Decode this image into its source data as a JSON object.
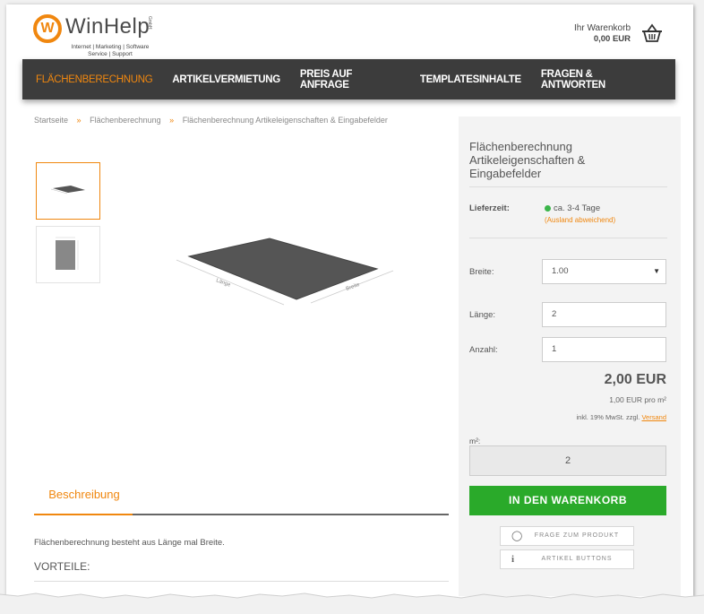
{
  "brand": {
    "name": "WinHelp",
    "legal": "GmbH",
    "tagline_line1": "Internet | Marketing | Software",
    "tagline_line2": "Service | Support",
    "accent_color": "#f0870f"
  },
  "cart": {
    "label": "Ihr Warenkorb",
    "amount": "0,00 EUR",
    "icon": "basket-icon"
  },
  "nav": {
    "items": [
      {
        "label": "FLÄCHENBERECHNUNG",
        "active": true
      },
      {
        "label": "ARTIKELVERMIETUNG"
      },
      {
        "label": "PREIS AUF ANFRAGE"
      },
      {
        "label": "TEMPLATESINHALTE"
      },
      {
        "label": "FRAGEN & ANTWORTEN"
      }
    ]
  },
  "breadcrumb": {
    "items": [
      "Startseite",
      "Flächenberechnung",
      "Flächenberechnung Artikeleigenschaften & Eingabefelder"
    ],
    "separator": "»"
  },
  "gallery": {
    "diagram_label_length": "Länge",
    "diagram_label_width": "Breite"
  },
  "product": {
    "title": "Flächenberechnung Artikeleigenschaften & Eingabefelder",
    "delivery_label": "Lieferzeit:",
    "delivery_value": "ca. 3-4 Tage",
    "delivery_note": "(Ausland abweichend)",
    "fields": {
      "breite_label": "Breite:",
      "breite_value": "1.00",
      "laenge_label": "Länge:",
      "laenge_value": "2",
      "anzahl_label": "Anzahl:",
      "anzahl_value": "1"
    },
    "price": "2,00 EUR",
    "unit_price": "1,00 EUR pro m²",
    "tax_text": "inkl. 19% MwSt. zzgl.",
    "shipping_link": "Versand",
    "m2_label": "m²:",
    "m2_value": "2",
    "add_to_cart": "IN DEN WARENKORB",
    "question_button": "FRAGE ZUM PRODUKT",
    "article_buttons": "ARTIKEL BUTTONS"
  },
  "tabs": {
    "description_tab": "Beschreibung",
    "description_text": "Flächenberechnung besteht aus Länge mal Breite.",
    "advantages_heading": "VORTEILE:"
  }
}
